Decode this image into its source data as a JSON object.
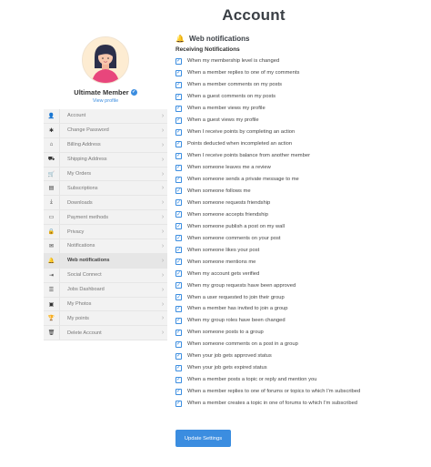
{
  "page": {
    "title": "Account"
  },
  "profile": {
    "name": "Ultimate Member",
    "view_profile": "View profile"
  },
  "nav": {
    "items": [
      {
        "label": "Account",
        "icon": "user-icon",
        "glyph": "👤"
      },
      {
        "label": "Change Password",
        "icon": "asterisk-icon",
        "glyph": "✱"
      },
      {
        "label": "Billing Address",
        "icon": "home-icon",
        "glyph": "⌂"
      },
      {
        "label": "Shipping Address",
        "icon": "truck-icon",
        "glyph": "⛟"
      },
      {
        "label": "My Orders",
        "icon": "cart-icon",
        "glyph": "🛒"
      },
      {
        "label": "Subscriptions",
        "icon": "book-icon",
        "glyph": "▤"
      },
      {
        "label": "Downloads",
        "icon": "download-icon",
        "glyph": "⤓"
      },
      {
        "label": "Payment methods",
        "icon": "credit-card-icon",
        "glyph": "▭"
      },
      {
        "label": "Privacy",
        "icon": "lock-icon",
        "glyph": "🔒"
      },
      {
        "label": "Notifications",
        "icon": "envelope-icon",
        "glyph": "✉"
      },
      {
        "label": "Web notifications",
        "icon": "bell-icon",
        "glyph": "🔔"
      },
      {
        "label": "Social Connect",
        "icon": "sign-in-icon",
        "glyph": "⇥"
      },
      {
        "label": "Jobs Dashboard",
        "icon": "list-icon",
        "glyph": "☰"
      },
      {
        "label": "My Photos",
        "icon": "image-icon",
        "glyph": "▣"
      },
      {
        "label": "My points",
        "icon": "trophy-icon",
        "glyph": "🏆"
      },
      {
        "label": "Delete Account",
        "icon": "trash-icon",
        "glyph": "🗑"
      }
    ],
    "active_index": 10
  },
  "section": {
    "title": "Web notifications",
    "subtitle": "Receiving Notifications",
    "options": [
      "When my membership level is changed",
      "When a member replies to one of my comments",
      "When a member comments on my posts",
      "When a guest comments on my posts",
      "When a member views my profile",
      "When a guest views my profile",
      "When I receive points by completing an action",
      "Points deducted when incompleted an action",
      "When I receive points balance from another member",
      "When someone leaves me a review",
      "When someone sends a private message to me",
      "When someone follows me",
      "When someone requests friendship",
      "When someone accepts friendship",
      "When someone publish a post on my wall",
      "When someone comments on your post",
      "When someone likes your post",
      "When someone mentions me",
      "When my account gets verified",
      "When my group requests have been approved",
      "When a user requested to join their group",
      "When a member has invited to join a group",
      "When my group roles have been changed",
      "When someone posts to a group",
      "When someone comments on a post in a group",
      "When your job gets approved status",
      "When your job gets expired status",
      "When a member posts a topic or reply and mention you",
      "When a member replies to one of forums or topics to which I'm subscribed",
      "When a member creates a topic in one of forums to which I'm subscribed"
    ]
  },
  "buttons": {
    "update": "Update Settings"
  },
  "colors": {
    "accent": "#3b8de0"
  }
}
